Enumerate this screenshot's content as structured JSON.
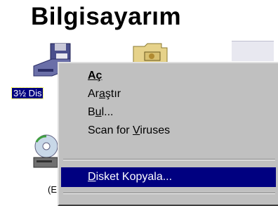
{
  "window": {
    "title": "Bilgisayarım"
  },
  "icons": [
    {
      "name": "floppy-drive",
      "label": "3½ Dis",
      "selected": true
    },
    {
      "name": "folder",
      "label": ""
    },
    {
      "name": "cd-drive",
      "label": "(E"
    }
  ],
  "context_menu": {
    "items": [
      {
        "pre": "",
        "ul": "Aç",
        "post": "",
        "bold": true
      },
      {
        "pre": "Ar",
        "ul": "a",
        "post": "ştır",
        "bold": false
      },
      {
        "pre": "B",
        "ul": "u",
        "post": "l...",
        "bold": false
      },
      {
        "pre": "Scan for ",
        "ul": "V",
        "post": "iruses",
        "bold": false
      },
      {
        "pre": "",
        "ul": "D",
        "post": "isket Kopyala...",
        "bold": false,
        "highlighted": true
      }
    ]
  },
  "colors": {
    "highlight": "#000080",
    "menu_bg": "#c0c0c0"
  }
}
